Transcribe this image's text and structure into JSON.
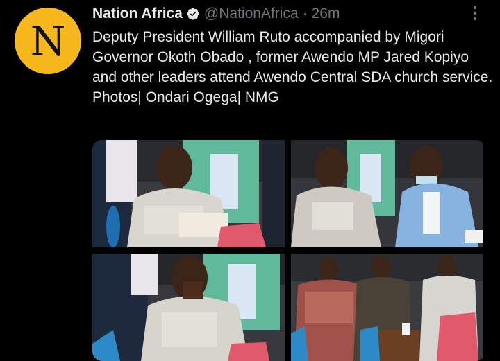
{
  "account": {
    "display_name": "Nation Africa",
    "handle": "@NationAfrica",
    "separator": "·",
    "time": "26m",
    "avatar_letter": "N",
    "avatar_color": "#f6b81c",
    "verified_icon": "verified-badge-icon"
  },
  "tweet": {
    "text": "Deputy President William Ruto accompanied by Migori Governor Okoth Obado , former Awendo MP Jared Kopiyo and other leaders attend Awendo Central SDA church service.",
    "credit": "Photos| Ondari Ogega| NMG"
  },
  "media": {
    "photos": [
      {
        "icon": "photo-ruto-reading-bible"
      },
      {
        "icon": "photo-ruto-with-governor"
      },
      {
        "icon": "photo-ruto-praying"
      },
      {
        "icon": "photo-church-congregation"
      }
    ]
  },
  "colors": {
    "background": "#000000",
    "text": "#e7e9ea",
    "secondary_text": "#71767b"
  }
}
